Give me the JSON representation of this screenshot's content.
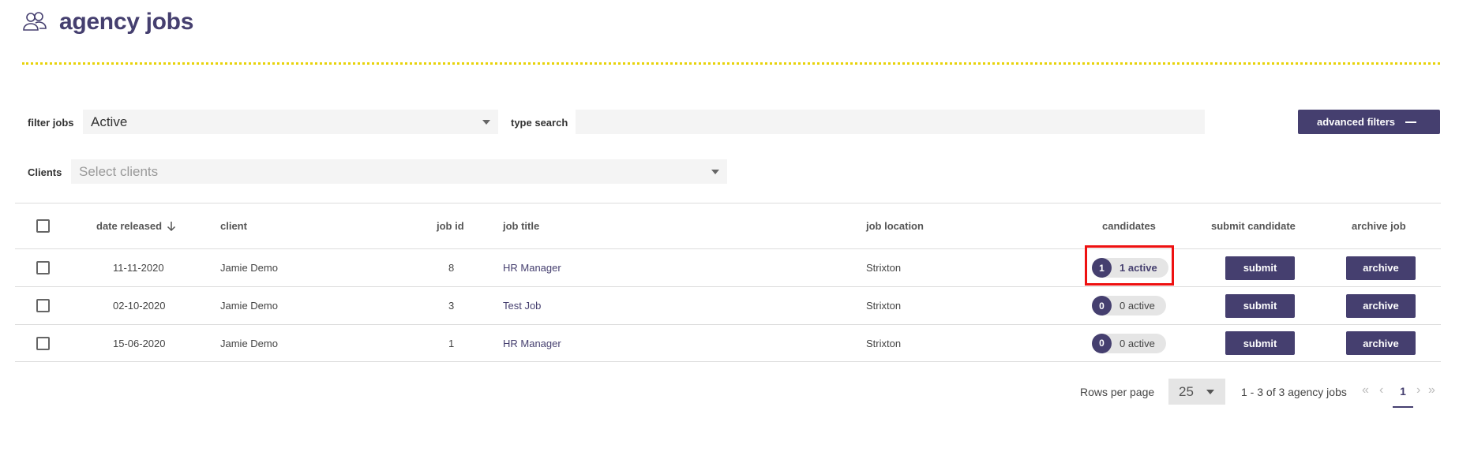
{
  "header": {
    "title": "agency jobs",
    "icon": "users-icon"
  },
  "filters": {
    "filter_jobs_label": "filter jobs",
    "filter_jobs_value": "Active",
    "type_search_label": "type search",
    "type_search_value": "",
    "advanced_filters_label": "advanced filters",
    "clients_label": "Clients",
    "clients_placeholder": "Select clients"
  },
  "table": {
    "columns": {
      "date_released": "date released",
      "client": "client",
      "job_id": "job id",
      "job_title": "job title",
      "job_location": "job location",
      "candidates": "candidates",
      "submit_candidate": "submit candidate",
      "archive_job": "archive job"
    },
    "sort": {
      "column": "date released",
      "direction": "descending"
    },
    "rows": [
      {
        "date": "11-11-2020",
        "client": "Jamie Demo",
        "job_id": "8",
        "job_title": "HR Manager",
        "location": "Strixton",
        "cand_count": "1",
        "cand_text": "1 active",
        "submit": "submit",
        "archive": "archive"
      },
      {
        "date": "02-10-2020",
        "client": "Jamie Demo",
        "job_id": "3",
        "job_title": "Test Job",
        "location": "Strixton",
        "cand_count": "0",
        "cand_text": "0 active",
        "submit": "submit",
        "archive": "archive"
      },
      {
        "date": "15-06-2020",
        "client": "Jamie Demo",
        "job_id": "1",
        "job_title": "HR Manager",
        "location": "Strixton",
        "cand_count": "0",
        "cand_text": "0 active",
        "submit": "submit",
        "archive": "archive"
      }
    ]
  },
  "pagination": {
    "rows_per_page_label": "Rows per page",
    "rows_per_page_value": "25",
    "range_text": "1 - 3 of 3 agency jobs",
    "current_page": "1",
    "first_symbol": "«",
    "prev_symbol": "‹",
    "next_symbol": "›",
    "last_symbol": "»"
  },
  "colors": {
    "brand": "#453f6f",
    "accent_dots": "#e8d30a",
    "highlight": "#ee1111"
  }
}
